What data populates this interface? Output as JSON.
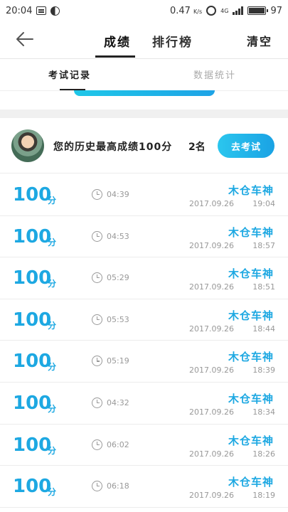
{
  "status_bar": {
    "time": "20:04",
    "speed": "0.47",
    "speed_unit": "K/s",
    "network": "4G",
    "battery": "97"
  },
  "nav": {
    "tab_score": "成绩",
    "tab_rank": "排行榜",
    "clear": "清空"
  },
  "subtabs": {
    "records": "考试记录",
    "stats": "数据统计"
  },
  "best": {
    "text": "您的历史最高成绩100分",
    "rank": "2名",
    "button": "去考试"
  },
  "records": [
    {
      "score": "100",
      "unit": "分",
      "duration": "04:39",
      "name": "木仓车神",
      "date": "2017.09.26",
      "time": "19:04"
    },
    {
      "score": "100",
      "unit": "分",
      "duration": "04:53",
      "name": "木仓车神",
      "date": "2017.09.26",
      "time": "18:57"
    },
    {
      "score": "100",
      "unit": "分",
      "duration": "05:29",
      "name": "木仓车神",
      "date": "2017.09.26",
      "time": "18:51"
    },
    {
      "score": "100",
      "unit": "分",
      "duration": "05:53",
      "name": "木仓车神",
      "date": "2017.09.26",
      "time": "18:44"
    },
    {
      "score": "100",
      "unit": "分",
      "duration": "05:19",
      "name": "木仓车神",
      "date": "2017.09.26",
      "time": "18:39"
    },
    {
      "score": "100",
      "unit": "分",
      "duration": "04:32",
      "name": "木仓车神",
      "date": "2017.09.26",
      "time": "18:34"
    },
    {
      "score": "100",
      "unit": "分",
      "duration": "06:02",
      "name": "木仓车神",
      "date": "2017.09.26",
      "time": "18:26"
    },
    {
      "score": "100",
      "unit": "分",
      "duration": "06:18",
      "name": "木仓车神",
      "date": "2017.09.26",
      "time": "18:19"
    }
  ]
}
